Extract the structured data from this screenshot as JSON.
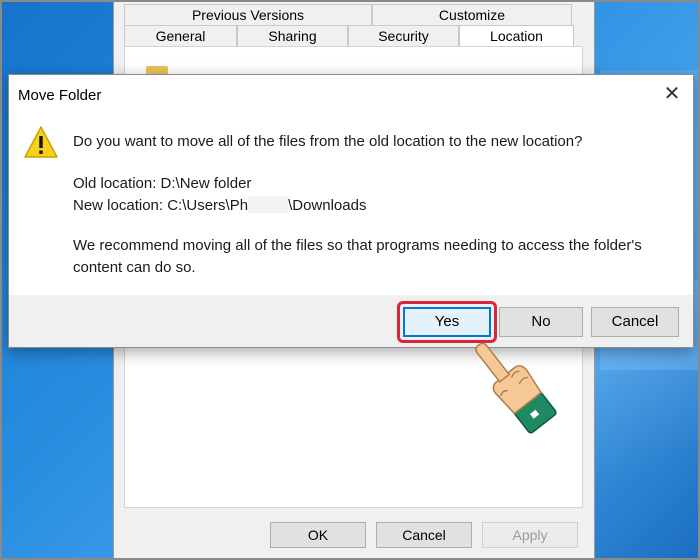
{
  "properties_window": {
    "tabs_top": [
      "Previous Versions",
      "Customize"
    ],
    "tabs_bottom": [
      "General",
      "Sharing",
      "Security",
      "Location"
    ],
    "active_tab": "Location",
    "buttons": {
      "ok": "OK",
      "cancel": "Cancel",
      "apply": "Apply"
    }
  },
  "dialog": {
    "title": "Move Folder",
    "close_glyph": "✕",
    "question": "Do you want to move all of the files from the old location to the new location?",
    "old_location_label": "Old location: ",
    "old_location_value": "D:\\New folder",
    "new_location_label": "New location: ",
    "new_location_prefix": "C:\\Users\\Ph",
    "new_location_suffix": "\\Downloads",
    "recommend_line1": "We recommend moving all of the files so that programs needing to access the folder's",
    "recommend_line2": "content can do so.",
    "buttons": {
      "yes": "Yes",
      "no": "No",
      "cancel": "Cancel"
    }
  },
  "icons": [
    "warning-icon",
    "close-icon",
    "folder-icon",
    "pointing-hand-icon"
  ],
  "colors": {
    "highlight": "#d6283a",
    "default_button_border": "#0078d7",
    "warning_yellow": "#f7d117",
    "desktop_blue": "#1f7fd6"
  }
}
